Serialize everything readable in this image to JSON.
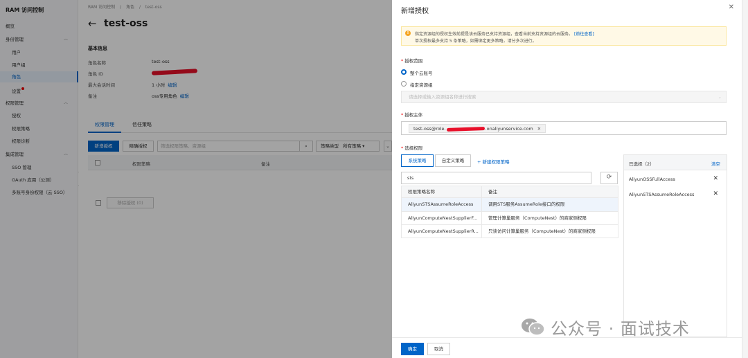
{
  "sidebar": {
    "title": "RAM 访问控制",
    "items": [
      {
        "label": "概览"
      },
      {
        "label": "身份管理"
      },
      {
        "label": "用户"
      },
      {
        "label": "用户组"
      },
      {
        "label": "角色"
      },
      {
        "label": "设置"
      },
      {
        "label": "权限管理"
      },
      {
        "label": "授权"
      },
      {
        "label": "权限策略"
      },
      {
        "label": "权限诊断"
      },
      {
        "label": "集成管理"
      },
      {
        "label": "SSO 管理"
      },
      {
        "label": "OAuth 应用（公测）"
      },
      {
        "label": "多账号身份权限（云 SSO）"
      }
    ]
  },
  "main": {
    "breadcrumb": [
      "RAM 访问控制",
      "/",
      "角色",
      "/",
      "test-oss"
    ],
    "title": "test-oss",
    "basic_info_title": "基本信息",
    "info": [
      {
        "key": "角色名称",
        "value": "test-oss",
        "link": ""
      },
      {
        "key": "角色 ID",
        "value": "",
        "link": ""
      },
      {
        "key": "最大会话时间",
        "value": "1 小时",
        "link": "编辑"
      },
      {
        "key": "备注",
        "value": "oss专用角色",
        "link": "编辑"
      }
    ],
    "tabs": [
      "权限管理",
      "信任策略"
    ],
    "add_btn": "新增授权",
    "precise_btn": "精确授权",
    "search_placeholder": "筛选权限策略、资源组",
    "policy_type_label": "策略类型",
    "policy_type_value": "所有策略",
    "table_headers": [
      "权限策略",
      "备注"
    ],
    "remove_btn": "移除授权 (0)"
  },
  "drawer": {
    "title": "新增授权",
    "notice_line1": "指定资源组的授权生效前提是该云服务已支持资源组，查看当前支持资源组的云服务。",
    "notice_link": "[前往查看]",
    "notice_line2": "单次授权最多支持 5 条策略，如需绑定更多策略，请分多次进行。",
    "scope_label": "授权范围",
    "scope_options": [
      "整个云账号",
      "指定资源组"
    ],
    "rg_placeholder": "请选择或输入资源组名称进行搜索",
    "principal_label": "授权主体",
    "principal_prefix": "test-oss@role.",
    "principal_suffix": ".onaliyunservice.com",
    "perm_label": "选择权限",
    "perm_tabs": [
      "系统策略",
      "自定义策略"
    ],
    "new_policy": "+ 新建权限策略",
    "search_value": "sts",
    "table_headers": [
      "权限策略名称",
      "备注"
    ],
    "policies": [
      {
        "name": "AliyunSTSAssumeRoleAccess",
        "note": "调用STS服务AssumeRole接口的权限"
      },
      {
        "name": "AliyunComputeNestSupplierF...",
        "note": "管理计算巢服务（ComputeNest）的商家侧权限"
      },
      {
        "name": "AliyunComputeNestSupplierR...",
        "note": "只读访问计算巢服务（ComputeNest）的商家侧权限"
      }
    ],
    "selected_title": "已选择（2）",
    "clear_label": "清空",
    "selected": [
      "AliyunOSSFullAccess",
      "AliyunSTSAssumeRoleAccess"
    ],
    "ok_btn": "确定",
    "cancel_btn": "取消"
  },
  "watermark": "公众号 · 面试技术",
  "colors": {
    "accent": "#0064c8",
    "warning_bg": "#fff9e6",
    "redaction": "#e8102a"
  }
}
